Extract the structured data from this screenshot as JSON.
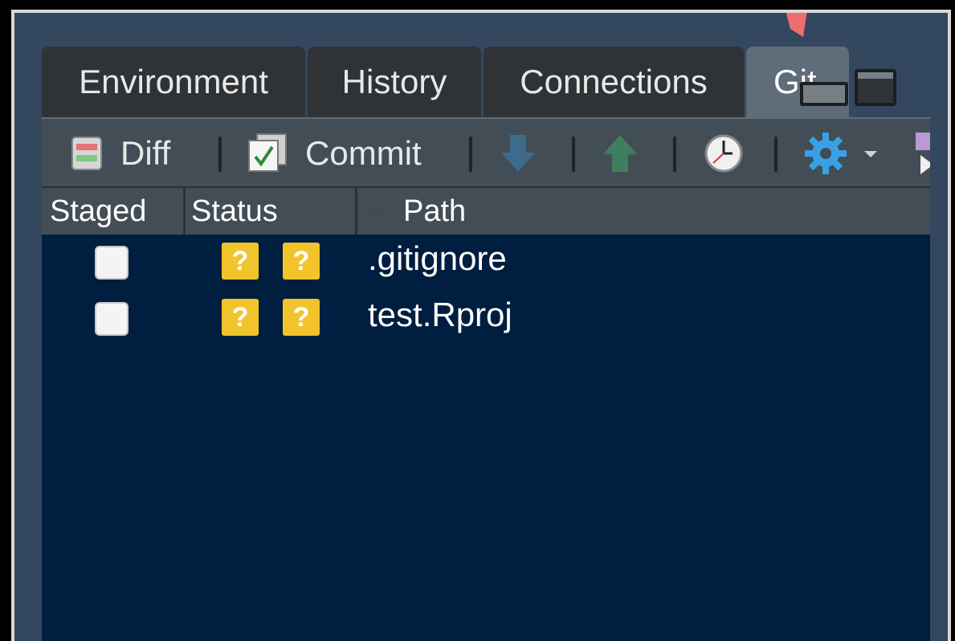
{
  "tabs": [
    {
      "label": "Environment"
    },
    {
      "label": "History"
    },
    {
      "label": "Connections"
    },
    {
      "label": "Git"
    }
  ],
  "toolbar": {
    "diff_label": "Diff",
    "commit_label": "Commit",
    "icons": [
      "diff-icon",
      "commit-icon",
      "pull-icon",
      "push-icon",
      "history-icon",
      "gear-icon",
      "dropdown-icon",
      "branch-icon"
    ]
  },
  "table": {
    "columns": [
      "Staged",
      "Status",
      "Path"
    ],
    "rows": [
      {
        "staged": false,
        "status": [
          "?",
          "?"
        ],
        "path": ".gitignore"
      },
      {
        "staged": false,
        "status": [
          "?",
          "?"
        ],
        "path": "test.Rproj"
      }
    ]
  },
  "colors": {
    "accent_arrow": "#f06d6d",
    "status_untracked": "#f2c42b",
    "pane_bg": "#001e3f"
  }
}
